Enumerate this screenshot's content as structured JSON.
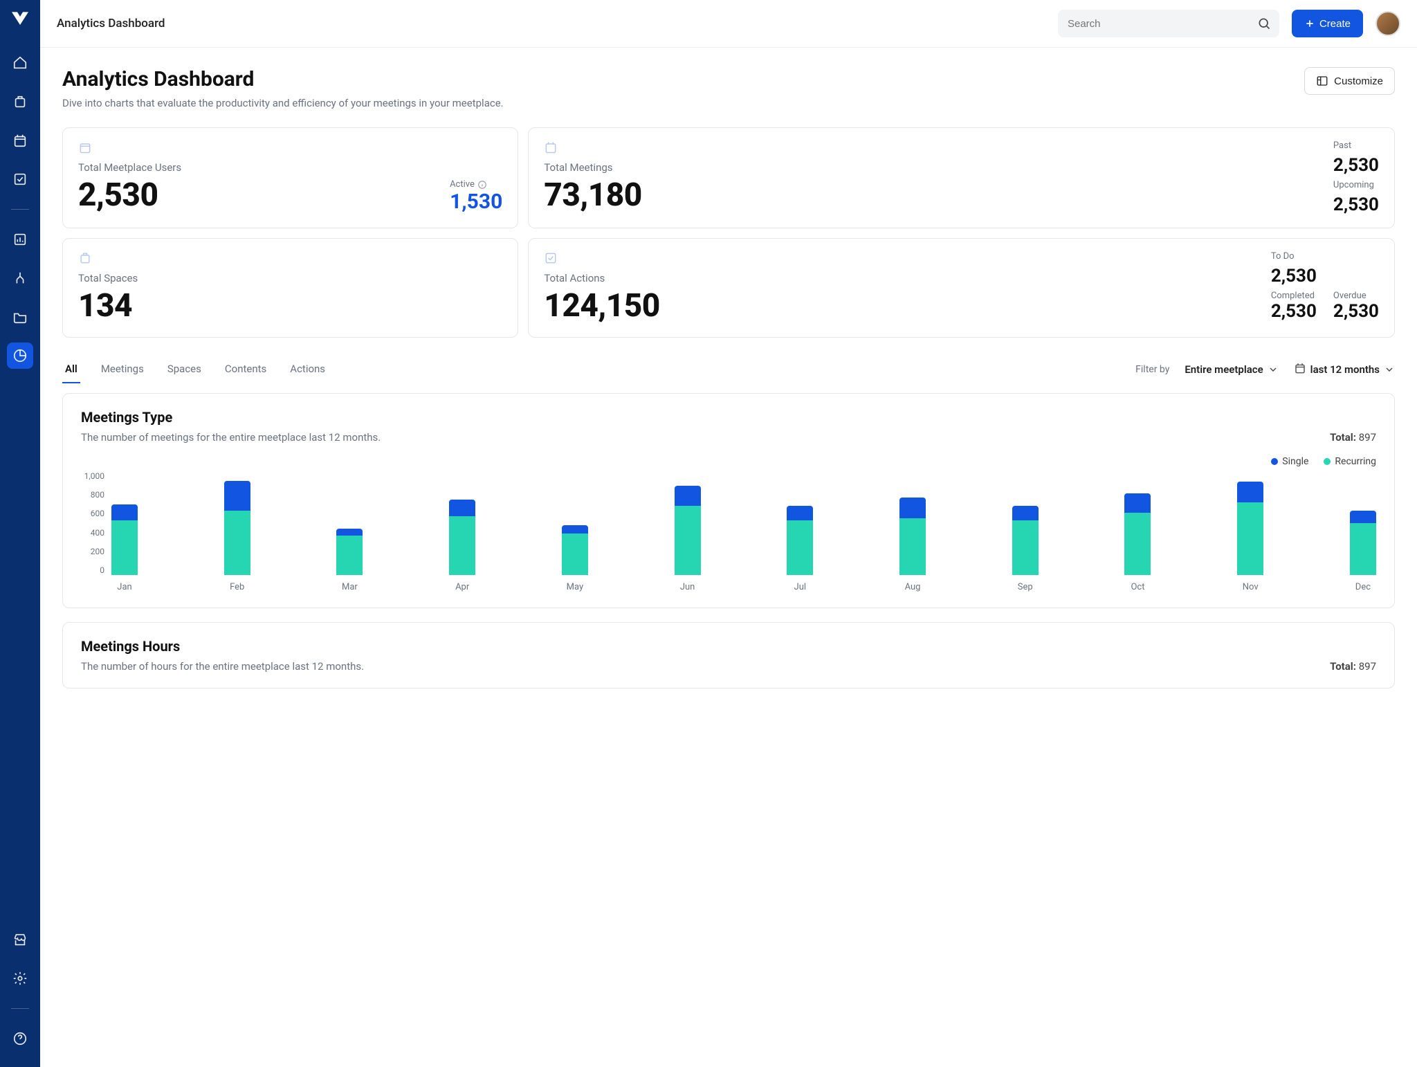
{
  "header": {
    "breadcrumb": "Analytics Dashboard",
    "search_placeholder": "Search",
    "create_label": "Create"
  },
  "page": {
    "title": "Analytics Dashboard",
    "subtitle": "Dive into charts that evaluate the productivity and efficiency of your meetings in your meetplace.",
    "customize_label": "Customize"
  },
  "kpi": {
    "users": {
      "label": "Total Meetplace Users",
      "value": "2,530",
      "active_label": "Active",
      "active_value": "1,530"
    },
    "meetings": {
      "label": "Total Meetings",
      "value": "73,180",
      "past_label": "Past",
      "past_value": "2,530",
      "upcoming_label": "Upcoming",
      "upcoming_value": "2,530"
    },
    "spaces": {
      "label": "Total Spaces",
      "value": "134"
    },
    "actions": {
      "label": "Total Actions",
      "value": "124,150",
      "todo_label": "To Do",
      "todo_value": "2,530",
      "completed_label": "Completed",
      "completed_value": "2,530",
      "overdue_label": "Overdue",
      "overdue_value": "2,530"
    }
  },
  "tabs": [
    "All",
    "Meetings",
    "Spaces",
    "Contents",
    "Actions"
  ],
  "active_tab": 0,
  "filters": {
    "label": "Filter by",
    "scope": "Entire meetplace",
    "range": "last 12 months"
  },
  "chart1": {
    "title": "Meetings Type",
    "subtitle": "The number of meetings for the entire meetplace last 12 months.",
    "total_label": "Total:",
    "total_value": "897",
    "legend": {
      "single": "Single",
      "recurring": "Recurring"
    }
  },
  "chart2": {
    "title": "Meetings Hours",
    "subtitle": "The number of hours for the entire meetplace last 12 months.",
    "total_label": "Total:",
    "total_value": "897"
  },
  "chart_data": {
    "type": "bar",
    "title": "Meetings Type",
    "ylabel": "",
    "ylim": [
      0,
      1000
    ],
    "y_ticks": [
      "1,000",
      "800",
      "600",
      "400",
      "200",
      "0"
    ],
    "categories": [
      "Jan",
      "Feb",
      "Mar",
      "Apr",
      "May",
      "Jun",
      "Jul",
      "Aug",
      "Sep",
      "Oct",
      "Nov",
      "Dec"
    ],
    "series": [
      {
        "name": "Recurring",
        "color": "#26d6b3",
        "values": [
          530,
          620,
          380,
          570,
          400,
          670,
          530,
          550,
          530,
          600,
          700,
          500
        ]
      },
      {
        "name": "Single",
        "color": "#1255e0",
        "values": [
          150,
          290,
          70,
          160,
          80,
          190,
          140,
          200,
          140,
          190,
          200,
          120
        ]
      }
    ]
  }
}
